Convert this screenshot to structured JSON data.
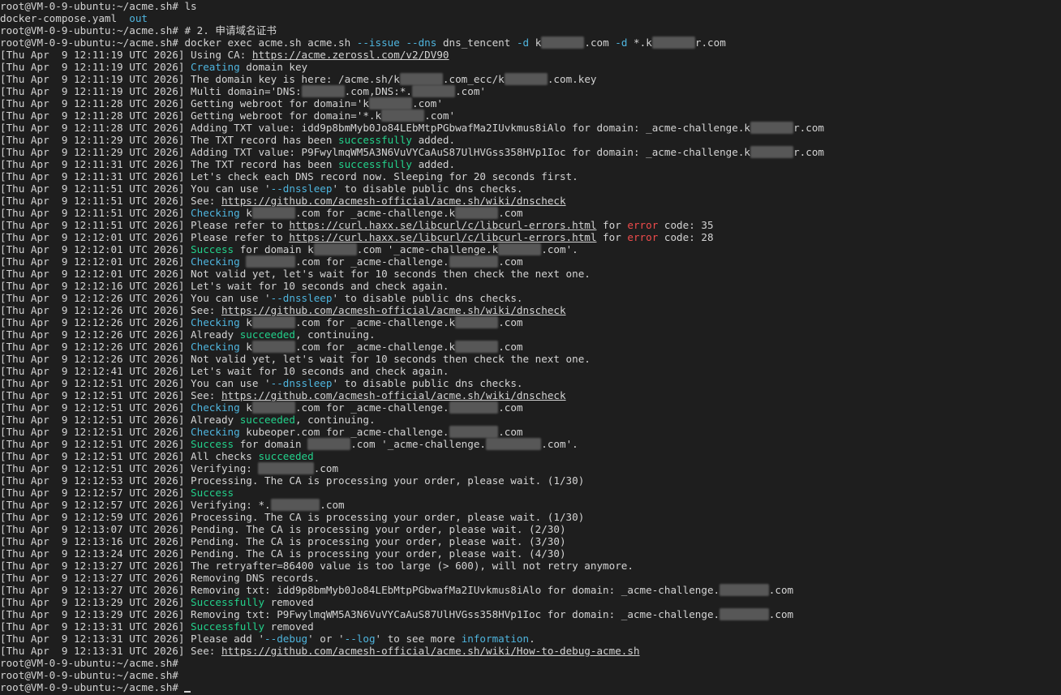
{
  "terminal": {
    "colors": {
      "background": "#1e1e1e",
      "text": "#d4d4d4",
      "info": "#4fb5de",
      "success": "#23d18b",
      "error": "#f14c4c",
      "redacted": "#6b6b6b"
    },
    "lines": [
      [
        {
          "t": "root@VM-0-9-ubuntu:~/acme.sh# ls"
        }
      ],
      [
        {
          "t": "docker-compose.yaml  "
        },
        {
          "t": "out",
          "c": "blue"
        }
      ],
      [
        {
          "t": "root@VM-0-9-ubuntu:~/acme.sh# # 2. 申请域名证书"
        }
      ],
      [
        {
          "t": "root@VM-0-9-ubuntu:~/acme.sh# docker exec acme.sh acme.sh "
        },
        {
          "t": "--issue",
          "c": "blue"
        },
        {
          "t": " "
        },
        {
          "t": "--dns",
          "c": "blue"
        },
        {
          "t": " dns_tencent "
        },
        {
          "t": "-d",
          "c": "blue"
        },
        {
          "t": " k"
        },
        {
          "t": "xxxxxxx",
          "c": "blur"
        },
        {
          "t": ".com "
        },
        {
          "t": "-d",
          "c": "blue"
        },
        {
          "t": " *.k"
        },
        {
          "t": "xxxxxxx",
          "c": "blur"
        },
        {
          "t": "r.com"
        }
      ],
      [
        {
          "t": "[Thu Apr  9 12:11:19 UTC 2026] Using CA: "
        },
        {
          "t": "https://acme.zerossl.com/v2/DV90",
          "c": "link"
        }
      ],
      [
        {
          "t": "[Thu Apr  9 12:11:19 UTC 2026] "
        },
        {
          "t": "Creating",
          "c": "blue"
        },
        {
          "t": " domain key"
        }
      ],
      [
        {
          "t": "[Thu Apr  9 12:11:19 UTC 2026] The domain key is here: /acme.sh/k"
        },
        {
          "t": "xxxxxxx",
          "c": "blur"
        },
        {
          "t": ".com_ecc/k"
        },
        {
          "t": "xxxxxxx",
          "c": "blur"
        },
        {
          "t": ".com.key"
        }
      ],
      [
        {
          "t": "[Thu Apr  9 12:11:19 UTC 2026] Multi domain='DNS:"
        },
        {
          "t": "xxxxxxx",
          "c": "blur"
        },
        {
          "t": ".com,DNS:*."
        },
        {
          "t": "xxxxxxx",
          "c": "blur"
        },
        {
          "t": ".com'"
        }
      ],
      [
        {
          "t": "[Thu Apr  9 12:11:28 UTC 2026] Getting webroot for domain='k"
        },
        {
          "t": "xxxxxxx",
          "c": "blur"
        },
        {
          "t": ".com'"
        }
      ],
      [
        {
          "t": "[Thu Apr  9 12:11:28 UTC 2026] Getting webroot for domain='*.k"
        },
        {
          "t": "xxxxxxx",
          "c": "blur"
        },
        {
          "t": ".com'"
        }
      ],
      [
        {
          "t": "[Thu Apr  9 12:11:28 UTC 2026] Adding TXT value: idd9p8bmMyb0Jo84LEbMtpPGbwafMa2IUvkmus8iAlo for domain: _acme-challenge.k"
        },
        {
          "t": "xxxxxxx",
          "c": "blur"
        },
        {
          "t": "r.com"
        }
      ],
      [
        {
          "t": "[Thu Apr  9 12:11:29 UTC 2026] The TXT record has been "
        },
        {
          "t": "successfully",
          "c": "green"
        },
        {
          "t": " added."
        }
      ],
      [
        {
          "t": "[Thu Apr  9 12:11:29 UTC 2026] Adding TXT value: P9FwylmqWM5A3N6VuVYCaAuS87UlHVGss358HVp1Ioc for domain: _acme-challenge.k"
        },
        {
          "t": "xxxxxxx",
          "c": "blur"
        },
        {
          "t": "r.com"
        }
      ],
      [
        {
          "t": "[Thu Apr  9 12:11:31 UTC 2026] The TXT record has been "
        },
        {
          "t": "successfully",
          "c": "green"
        },
        {
          "t": " added."
        }
      ],
      [
        {
          "t": "[Thu Apr  9 12:11:31 UTC 2026] Let's check each DNS record now. Sleeping for 20 seconds first."
        }
      ],
      [
        {
          "t": "[Thu Apr  9 12:11:51 UTC 2026] You can use '"
        },
        {
          "t": "--dnssleep",
          "c": "blue"
        },
        {
          "t": "' to disable public dns checks."
        }
      ],
      [
        {
          "t": "[Thu Apr  9 12:11:51 UTC 2026] See: "
        },
        {
          "t": "https://github.com/acmesh-official/acme.sh/wiki/dnscheck",
          "c": "link"
        }
      ],
      [
        {
          "t": "[Thu Apr  9 12:11:51 UTC 2026] "
        },
        {
          "t": "Checking",
          "c": "blue"
        },
        {
          "t": " k"
        },
        {
          "t": "xxxxxxx",
          "c": "blur"
        },
        {
          "t": ".com for _acme-challenge.k"
        },
        {
          "t": "xxxxxxx",
          "c": "blur"
        },
        {
          "t": ".com"
        }
      ],
      [
        {
          "t": "[Thu Apr  9 12:11:51 UTC 2026] Please refer to "
        },
        {
          "t": "https://curl.haxx.se/libcurl/c/libcurl-errors.html",
          "c": "link"
        },
        {
          "t": " for "
        },
        {
          "t": "error",
          "c": "red"
        },
        {
          "t": " code: 35"
        }
      ],
      [
        {
          "t": "[Thu Apr  9 12:12:01 UTC 2026] Please refer to "
        },
        {
          "t": "https://curl.haxx.se/libcurl/c/libcurl-errors.html",
          "c": "link"
        },
        {
          "t": " for "
        },
        {
          "t": "error",
          "c": "red"
        },
        {
          "t": " code: 28"
        }
      ],
      [
        {
          "t": "[Thu Apr  9 12:12:01 UTC 2026] "
        },
        {
          "t": "Success",
          "c": "green"
        },
        {
          "t": " for domain k"
        },
        {
          "t": "xxxxxxx",
          "c": "blur"
        },
        {
          "t": ".com '_acme-challenge.k"
        },
        {
          "t": "xxxxxxx",
          "c": "blur"
        },
        {
          "t": ".com'."
        }
      ],
      [
        {
          "t": "[Thu Apr  9 12:12:01 UTC 2026] "
        },
        {
          "t": "Checking",
          "c": "blue"
        },
        {
          "t": " "
        },
        {
          "t": "xxxxxxxx",
          "c": "blur"
        },
        {
          "t": ".com for _acme-challenge."
        },
        {
          "t": "xxxxxxxx",
          "c": "blur"
        },
        {
          "t": ".com"
        }
      ],
      [
        {
          "t": "[Thu Apr  9 12:12:01 UTC 2026] Not valid yet, let's wait for 10 seconds then check the next one."
        }
      ],
      [
        {
          "t": "[Thu Apr  9 12:12:16 UTC 2026] Let's wait for 10 seconds and check again."
        }
      ],
      [
        {
          "t": "[Thu Apr  9 12:12:26 UTC 2026] You can use '"
        },
        {
          "t": "--dnssleep",
          "c": "blue"
        },
        {
          "t": "' to disable public dns checks."
        }
      ],
      [
        {
          "t": "[Thu Apr  9 12:12:26 UTC 2026] See: "
        },
        {
          "t": "https://github.com/acmesh-official/acme.sh/wiki/dnscheck",
          "c": "link"
        }
      ],
      [
        {
          "t": "[Thu Apr  9 12:12:26 UTC 2026] "
        },
        {
          "t": "Checking",
          "c": "blue"
        },
        {
          "t": " k"
        },
        {
          "t": "xxxxxxx",
          "c": "blur"
        },
        {
          "t": ".com for _acme-challenge.k"
        },
        {
          "t": "xxxxxxx",
          "c": "blur"
        },
        {
          "t": ".com"
        }
      ],
      [
        {
          "t": "[Thu Apr  9 12:12:26 UTC 2026] Already "
        },
        {
          "t": "succeeded",
          "c": "green"
        },
        {
          "t": ", continuing."
        }
      ],
      [
        {
          "t": "[Thu Apr  9 12:12:26 UTC 2026] "
        },
        {
          "t": "Checking",
          "c": "blue"
        },
        {
          "t": " k"
        },
        {
          "t": "xxxxxxx",
          "c": "blur"
        },
        {
          "t": ".com for _acme-challenge.k"
        },
        {
          "t": "xxxxxxx",
          "c": "blur"
        },
        {
          "t": ".com"
        }
      ],
      [
        {
          "t": "[Thu Apr  9 12:12:26 UTC 2026] Not valid yet, let's wait for 10 seconds then check the next one."
        }
      ],
      [
        {
          "t": "[Thu Apr  9 12:12:41 UTC 2026] Let's wait for 10 seconds and check again."
        }
      ],
      [
        {
          "t": "[Thu Apr  9 12:12:51 UTC 2026] You can use '"
        },
        {
          "t": "--dnssleep",
          "c": "blue"
        },
        {
          "t": "' to disable public dns checks."
        }
      ],
      [
        {
          "t": "[Thu Apr  9 12:12:51 UTC 2026] See: "
        },
        {
          "t": "https://github.com/acmesh-official/acme.sh/wiki/dnscheck",
          "c": "link"
        }
      ],
      [
        {
          "t": "[Thu Apr  9 12:12:51 UTC 2026] "
        },
        {
          "t": "Checking",
          "c": "blue"
        },
        {
          "t": " k"
        },
        {
          "t": "xxxxxxx",
          "c": "blur"
        },
        {
          "t": ".com for _acme-challenge."
        },
        {
          "t": "xxxxxxxx",
          "c": "blur"
        },
        {
          "t": ".com"
        }
      ],
      [
        {
          "t": "[Thu Apr  9 12:12:51 UTC 2026] Already "
        },
        {
          "t": "succeeded",
          "c": "green"
        },
        {
          "t": ", continuing."
        }
      ],
      [
        {
          "t": "[Thu Apr  9 12:12:51 UTC 2026] "
        },
        {
          "t": "Checking",
          "c": "blue"
        },
        {
          "t": " kubeoper.com for _acme-challenge."
        },
        {
          "t": "xxxxxxxx",
          "c": "blur"
        },
        {
          "t": ".com"
        }
      ],
      [
        {
          "t": "[Thu Apr  9 12:12:51 UTC 2026] "
        },
        {
          "t": "Success",
          "c": "green"
        },
        {
          "t": " for domain "
        },
        {
          "t": "xxxxxxx",
          "c": "blur"
        },
        {
          "t": ".com '_acme-challenge."
        },
        {
          "t": "xxxxxxxxx",
          "c": "blur"
        },
        {
          "t": ".com'."
        }
      ],
      [
        {
          "t": "[Thu Apr  9 12:12:51 UTC 2026] All checks "
        },
        {
          "t": "succeeded",
          "c": "green"
        }
      ],
      [
        {
          "t": "[Thu Apr  9 12:12:51 UTC 2026] Verifying: "
        },
        {
          "t": "xxxxxxxxx",
          "c": "blur"
        },
        {
          "t": ".com"
        }
      ],
      [
        {
          "t": "[Thu Apr  9 12:12:53 UTC 2026] Processing. The CA is processing your order, please wait. (1/30)"
        }
      ],
      [
        {
          "t": "[Thu Apr  9 12:12:57 UTC 2026] "
        },
        {
          "t": "Success",
          "c": "green"
        }
      ],
      [
        {
          "t": "[Thu Apr  9 12:12:57 UTC 2026] Verifying: *."
        },
        {
          "t": "xxxxxxxx",
          "c": "blur"
        },
        {
          "t": ".com"
        }
      ],
      [
        {
          "t": "[Thu Apr  9 12:12:59 UTC 2026] Processing. The CA is processing your order, please wait. (1/30)"
        }
      ],
      [
        {
          "t": "[Thu Apr  9 12:13:07 UTC 2026] Pending. The CA is processing your order, please wait. (2/30)"
        }
      ],
      [
        {
          "t": "[Thu Apr  9 12:13:16 UTC 2026] Pending. The CA is processing your order, please wait. (3/30)"
        }
      ],
      [
        {
          "t": "[Thu Apr  9 12:13:24 UTC 2026] Pending. The CA is processing your order, please wait. (4/30)"
        }
      ],
      [
        {
          "t": "[Thu Apr  9 12:13:27 UTC 2026] The retryafter=86400 value is too large (> 600), will not retry anymore."
        }
      ],
      [
        {
          "t": "[Thu Apr  9 12:13:27 UTC 2026] Removing DNS records."
        }
      ],
      [
        {
          "t": "[Thu Apr  9 12:13:27 UTC 2026] Removing txt: idd9p8bmMyb0Jo84LEbMtpPGbwafMa2IUvkmus8iAlo for domain: _acme-challenge."
        },
        {
          "t": "xxxxxxxx",
          "c": "blur"
        },
        {
          "t": ".com"
        }
      ],
      [
        {
          "t": "[Thu Apr  9 12:13:29 UTC 2026] "
        },
        {
          "t": "Successfully",
          "c": "green"
        },
        {
          "t": " removed"
        }
      ],
      [
        {
          "t": "[Thu Apr  9 12:13:29 UTC 2026] Removing txt: P9FwylmqWM5A3N6VuVYCaAuS87UlHVGss358HVp1Ioc for domain: _acme-challenge."
        },
        {
          "t": "xxxxxxxx",
          "c": "blur"
        },
        {
          "t": ".com"
        }
      ],
      [
        {
          "t": "[Thu Apr  9 12:13:31 UTC 2026] "
        },
        {
          "t": "Successfully",
          "c": "green"
        },
        {
          "t": " removed"
        }
      ],
      [
        {
          "t": "[Thu Apr  9 12:13:31 UTC 2026] Please add '"
        },
        {
          "t": "--debug",
          "c": "blue"
        },
        {
          "t": "' or '"
        },
        {
          "t": "--log",
          "c": "blue"
        },
        {
          "t": "' to see more "
        },
        {
          "t": "information",
          "c": "blue"
        },
        {
          "t": "."
        }
      ],
      [
        {
          "t": "[Thu Apr  9 12:13:31 UTC 2026] See: "
        },
        {
          "t": "https://github.com/acmesh-official/acme.sh/wiki/How-to-debug-acme.sh",
          "c": "link"
        }
      ],
      [
        {
          "t": "root@VM-0-9-ubuntu:~/acme.sh#"
        }
      ],
      [
        {
          "t": "root@VM-0-9-ubuntu:~/acme.sh#"
        }
      ],
      [
        {
          "t": "root@VM-0-9-ubuntu:~/acme.sh# "
        },
        {
          "t": "cursor",
          "c": "cursor"
        }
      ]
    ]
  }
}
